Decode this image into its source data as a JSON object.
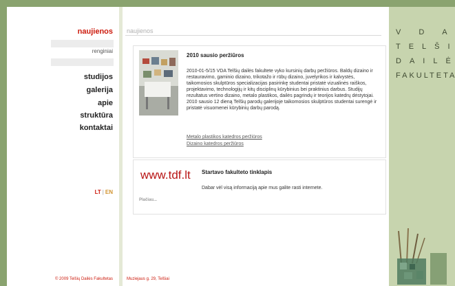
{
  "nav": {
    "news": "naujienos",
    "events": "renginiai",
    "studies": "studijos",
    "gallery": "galerija",
    "about": "apie",
    "structure": "struktūra",
    "contacts": "kontaktai"
  },
  "lang": {
    "lt": "LT",
    "separator": "|",
    "en": "EN"
  },
  "copyright": "© 2009 Telšių Dailės Fakultetas",
  "section": {
    "title": "naujienos"
  },
  "news": [
    {
      "title": "2010 sausio peržiūros",
      "body": "2010-01-5/15 VDA Telšių dailės fakultete vyko kursinių darbų peržiūros. Baldų dizaino ir restauravimo, gaminio dizaino, trikotažo ir rūbų dizaino, juvelyrikos ir kalvystės, taikomosios skulptūros specializacijas pasirinkę studentai pristatė vizualinės raiškos, projektavimo, technologijų ir kitų disciplinų kūrybinius bei praktinius darbus. Studijų rezultatus vertino dizaino, metalo plastikos, dailės pagrindų ir teorijos katedrų dėstytojai. 2010 sausio 12 dieną Telšių parodų galerijoje taikomosios skulptūros studentai surengė ir pristatė visuomenei kūrybinių darbų parodą.",
      "links": [
        "Metalo plastikos katedros peržiūros",
        "Dizaino katedros peržiūros"
      ]
    },
    {
      "logo": "www.tdf.lt",
      "title": "Startavo fakulteto tinklapis",
      "body": "Dabar vėl visą informaciją apie mus galite rasti internete.",
      "more": "Plačiau..."
    }
  ],
  "address": "Muziejaus g. 29, Telšiai",
  "watermark": {
    "line1": "VDA",
    "line2": "TELŠIŲ",
    "line3": "DAILĖS",
    "line4": "FAKULTETAS"
  },
  "colors": {
    "accent": "#cc1a0c",
    "background": "#8aa36f",
    "side_panel": "#c7d4ae",
    "lang_en": "#d1932f"
  }
}
